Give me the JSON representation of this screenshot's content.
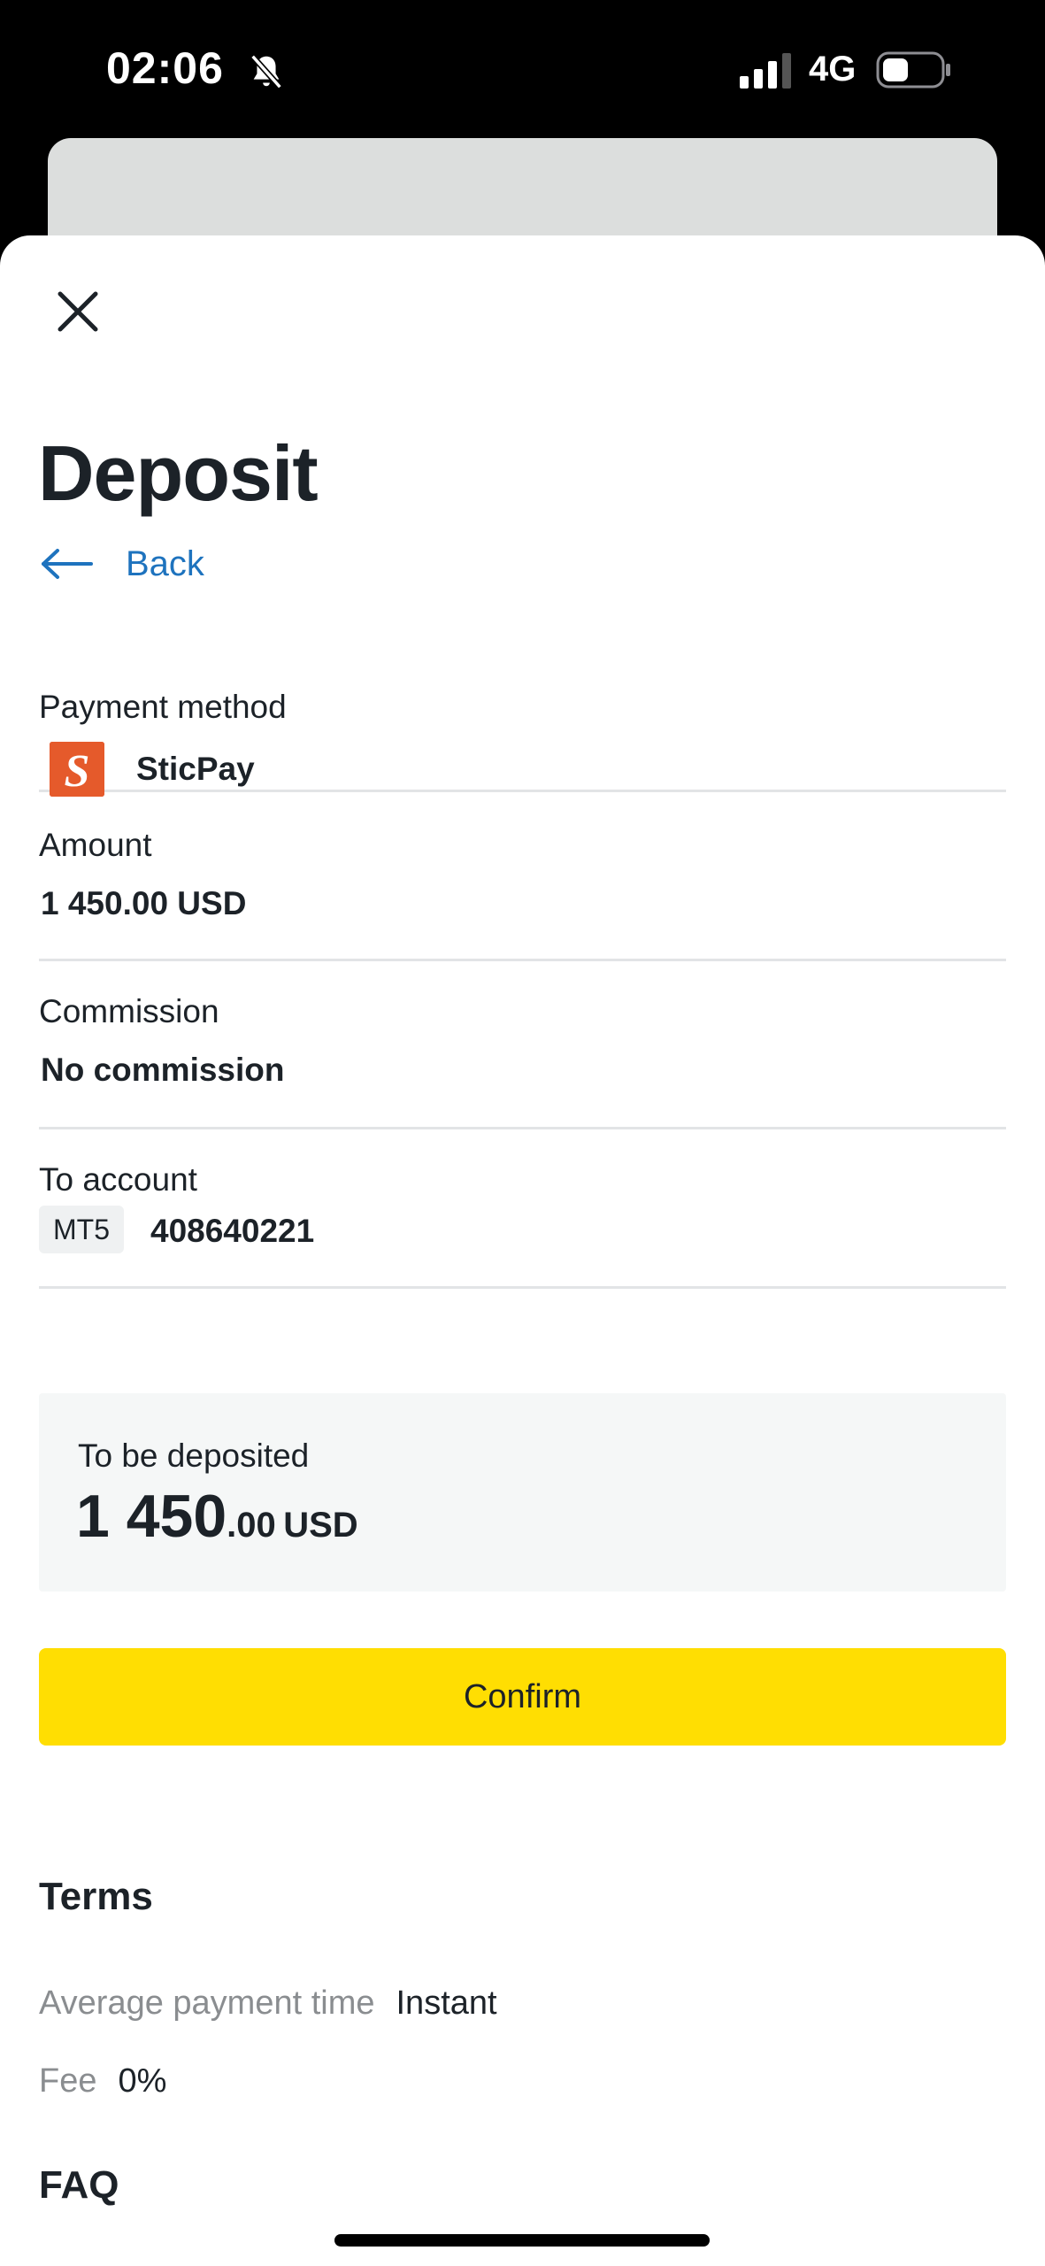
{
  "status_bar": {
    "time": "02:06",
    "network": "4G",
    "icons": [
      "bell-muted-icon",
      "signal-icon",
      "battery-icon"
    ]
  },
  "sheet": {
    "close_icon": "close-icon",
    "title": "Deposit",
    "back_label": "Back",
    "back_icon": "arrow-left-icon"
  },
  "details": {
    "payment_method": {
      "label": "Payment method",
      "value": "SticPay",
      "logo": "sticpay-logo",
      "logo_letter": "S"
    },
    "amount": {
      "label": "Amount",
      "value": "1 450.00 USD"
    },
    "commission": {
      "label": "Commission",
      "value": "No commission"
    },
    "to_account": {
      "label": "To account",
      "badge": "MT5",
      "value": "408640221"
    }
  },
  "summary": {
    "label": "To be deposited",
    "amount_int": "1 450",
    "amount_dec": ".00",
    "currency": "USD"
  },
  "confirm_label": "Confirm",
  "terms": {
    "title": "Terms",
    "payment_time_label": "Average payment time",
    "payment_time_value": "Instant",
    "fee_label": "Fee",
    "fee_value": "0%"
  },
  "faq_title": "FAQ",
  "colors": {
    "accent_button": "#ffde02",
    "link": "#1e73be",
    "sticpay": "#e55a2b",
    "text": "#1c2228",
    "muted_text": "#8a8d90"
  }
}
